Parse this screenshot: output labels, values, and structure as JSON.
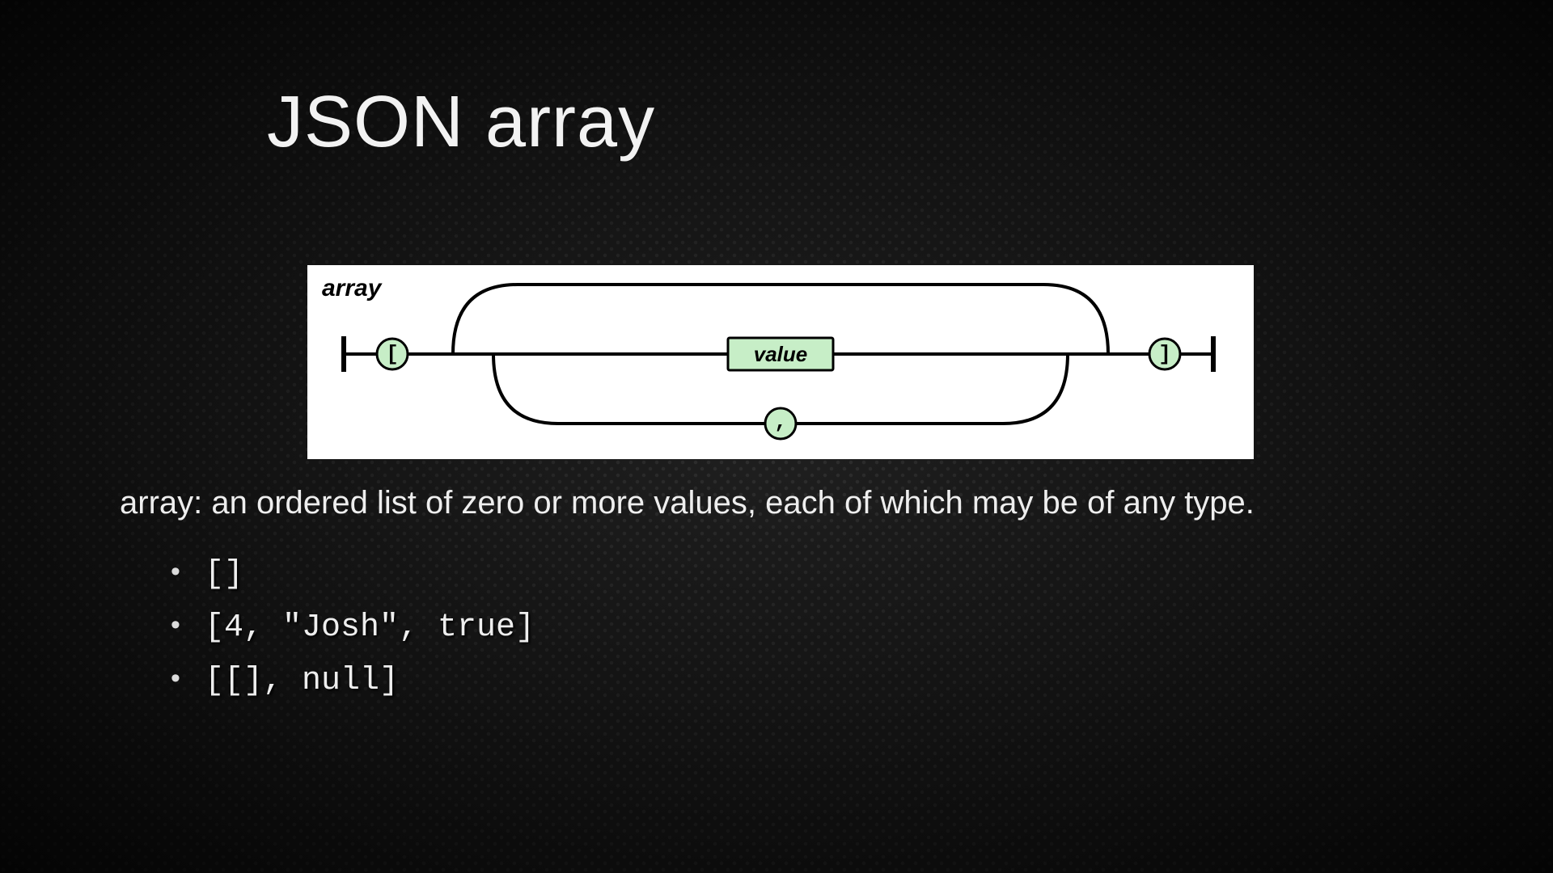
{
  "title": "JSON array",
  "diagram": {
    "label": "array",
    "open_bracket": "[",
    "close_bracket": "]",
    "value_box": "value",
    "separator": ","
  },
  "definition": "array: an ordered list of zero or more values, each of which may be of any type.",
  "examples": [
    "[]",
    "[4, \"Josh\", true]",
    "[[], null]"
  ]
}
